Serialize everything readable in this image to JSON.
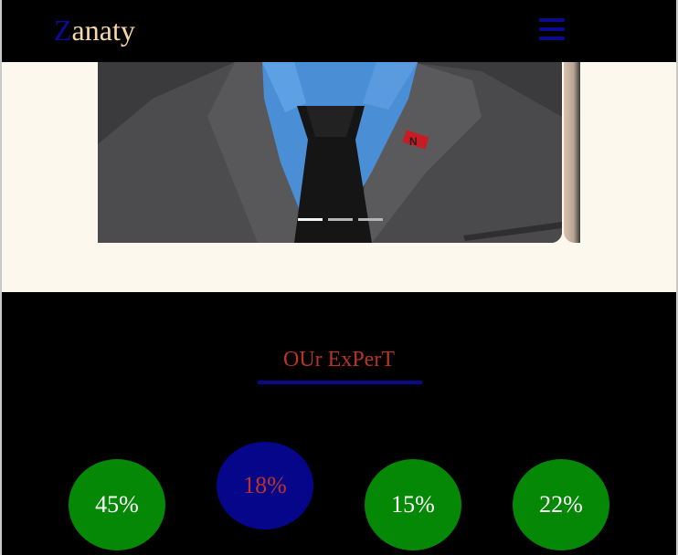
{
  "navbar": {
    "brand_initial": "Z",
    "brand_rest": "anaty",
    "menu_icon": "hamburger-menu-icon"
  },
  "hero": {
    "slide_count": 3,
    "active_slide": 1,
    "pin_letter": "N"
  },
  "expert": {
    "title": "OUr ExPerT",
    "stats": [
      {
        "value": "45%",
        "color": "#058805"
      },
      {
        "value": "18%",
        "color": "#06068a"
      },
      {
        "value": "15%",
        "color": "#058805"
      },
      {
        "value": "22%",
        "color": "#058805"
      }
    ]
  },
  "colors": {
    "brand_accent": "#0b0b9a",
    "brand_text": "#f7d9a8",
    "title_red": "#b9332b",
    "page_bg": "#fdf8ee"
  }
}
